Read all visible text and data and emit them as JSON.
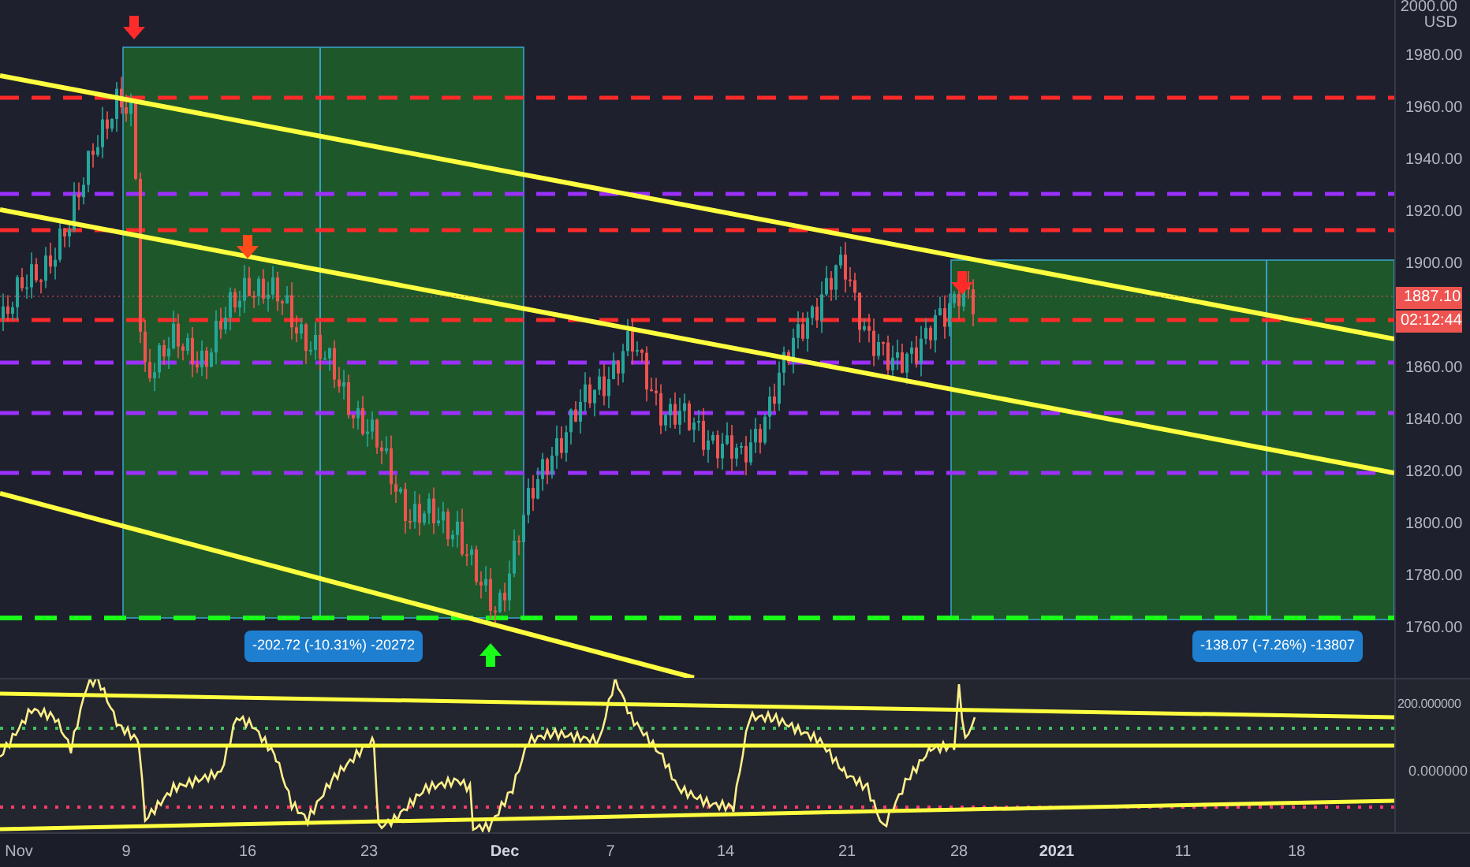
{
  "price_axis": {
    "top_label": "2000.00",
    "currency": "USD",
    "ticks": [
      "1980.00",
      "1960.00",
      "1940.00",
      "1920.00",
      "1900.00",
      "1860.00",
      "1840.00",
      "1820.00",
      "1800.00",
      "1780.00",
      "1760.00"
    ]
  },
  "last_price": "1887.10",
  "countdown": "02:12:44",
  "measurements": [
    "-202.72 (-10.31%) -20272",
    "-138.07 (-7.26%) -13807"
  ],
  "indicator_axis": [
    "200.000000",
    "0.000000"
  ],
  "time_axis": [
    {
      "label": "Nov",
      "bold": false
    },
    {
      "label": "9",
      "bold": false
    },
    {
      "label": "16",
      "bold": false
    },
    {
      "label": "23",
      "bold": false
    },
    {
      "label": "Dec",
      "bold": true
    },
    {
      "label": "7",
      "bold": false
    },
    {
      "label": "14",
      "bold": false
    },
    {
      "label": "21",
      "bold": false
    },
    {
      "label": "28",
      "bold": false
    },
    {
      "label": "2021",
      "bold": true
    },
    {
      "label": "11",
      "bold": false
    },
    {
      "label": "18",
      "bold": false
    }
  ]
}
